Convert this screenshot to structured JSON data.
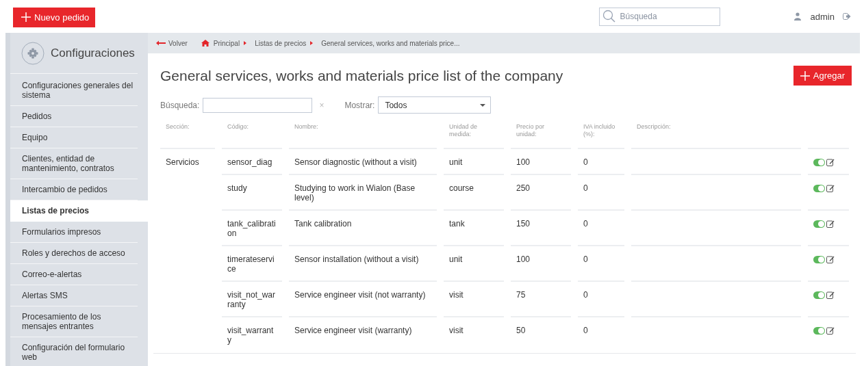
{
  "topbar": {
    "new_order_button": "Nuevo pedido",
    "search": {
      "placeholder": "Búsqueda"
    },
    "user": "admin"
  },
  "sidebar": {
    "title": "Configuraciones",
    "items": [
      {
        "label": "Configuraciones generales del sistema",
        "selected": false
      },
      {
        "label": "Pedidos",
        "selected": false
      },
      {
        "label": "Equipo",
        "selected": false
      },
      {
        "label": "Clientes, entidad de mantenimiento, contratos",
        "selected": false
      },
      {
        "label": "Intercambio de pedidos",
        "selected": false
      },
      {
        "label": "Listas de precios",
        "selected": true
      },
      {
        "label": "Formularios impresos",
        "selected": false
      },
      {
        "label": "Roles y derechos de acceso",
        "selected": false
      },
      {
        "label": "Correo-e-alertas",
        "selected": false
      },
      {
        "label": "Alertas SMS",
        "selected": false
      },
      {
        "label": "Procesamiento de los mensajes entrantes",
        "selected": false
      },
      {
        "label": "Configuración del formulario web",
        "selected": false
      }
    ]
  },
  "breadcrumb": {
    "back": "Volver",
    "items": [
      "Principal",
      "Listas de precios",
      "General services, works and materials price..."
    ]
  },
  "page_title": "General services, works and materials price list of the company",
  "add_button": "Agregar",
  "filters": {
    "search_label": "Búsqueda:",
    "clear": "×",
    "show_label": "Mostrar:",
    "show_value": "Todos"
  },
  "table": {
    "columns": [
      "Sección:",
      "Código:",
      "Nombre:",
      "Unidad de medida:",
      "Precio por unidad:",
      "IVA incluido (%):",
      "Descripción:"
    ],
    "rows": [
      {
        "section": "Servicios",
        "code": "sensor_diag",
        "name": "Sensor diagnostic (without a visit)",
        "unit": "unit",
        "price": "100",
        "vat": "0",
        "on": true
      },
      {
        "code": "study",
        "name": "Studying to work in Wialon (Base level)",
        "unit": "course",
        "price": "250",
        "vat": "0",
        "on": true
      },
      {
        "code": "tank_calibration",
        "name": "Tank calibration",
        "unit": "tank",
        "price": "150",
        "vat": "0",
        "on": true
      },
      {
        "code": "timerateservice",
        "name": "Sensor installation (without a visit)",
        "unit": "unit",
        "price": "100",
        "vat": "0",
        "on": true
      },
      {
        "code": "visit_not_warranty",
        "name": "Service engineer visit (not warranty)",
        "unit": "visit",
        "price": "75",
        "vat": "0",
        "on": true
      },
      {
        "code": "visit_warranty",
        "name": "Service engineer visit (warranty)",
        "unit": "visit",
        "price": "50",
        "vat": "0",
        "on": true
      }
    ]
  }
}
